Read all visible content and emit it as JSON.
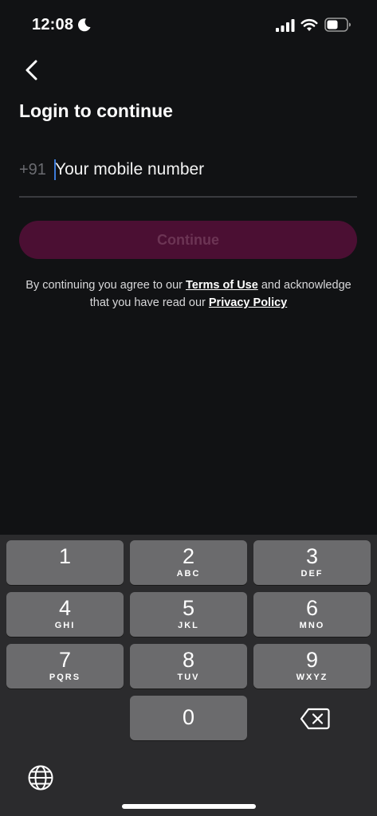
{
  "status_bar": {
    "time": "12:08"
  },
  "header": {
    "title": "Login to continue"
  },
  "login": {
    "country_code": "+91",
    "phone_placeholder": "Your mobile number",
    "phone_value": "",
    "continue_label": "Continue"
  },
  "legal": {
    "prefix": "By continuing you agree to our",
    "terms": "Terms of Use",
    "middle": "and acknowledge that you have read our",
    "privacy": "Privacy Policy"
  },
  "keyboard": {
    "keys": [
      {
        "digit": "1",
        "letters": ""
      },
      {
        "digit": "2",
        "letters": "ABC"
      },
      {
        "digit": "3",
        "letters": "DEF"
      },
      {
        "digit": "4",
        "letters": "GHI"
      },
      {
        "digit": "5",
        "letters": "JKL"
      },
      {
        "digit": "6",
        "letters": "MNO"
      },
      {
        "digit": "7",
        "letters": "PQRS"
      },
      {
        "digit": "8",
        "letters": "TUV"
      },
      {
        "digit": "9",
        "letters": "WXYZ"
      },
      {
        "digit": "0",
        "letters": ""
      }
    ]
  },
  "colors": {
    "background": "#111214",
    "button_bg": "#4b0f33",
    "button_text": "#6c3454",
    "key_bg": "#6b6b6d",
    "keyboard_bg": "#2b2b2d",
    "caret": "#3d7bd9"
  },
  "icons": [
    "moon-icon",
    "signal-icon",
    "wifi-icon",
    "battery-icon",
    "back-chevron-icon",
    "delete-icon",
    "globe-icon"
  ]
}
